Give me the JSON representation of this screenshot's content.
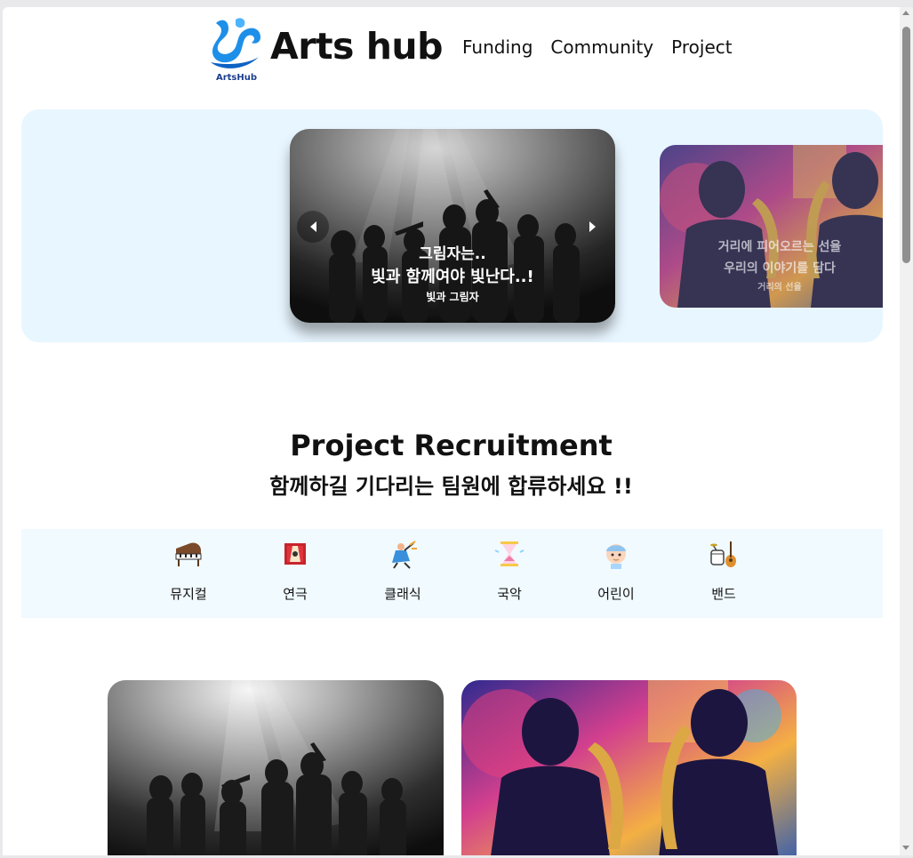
{
  "header": {
    "logo_caption": "ArtsHub",
    "brand_title": "Arts hub",
    "nav": [
      "Funding",
      "Community",
      "Project"
    ]
  },
  "banner": {
    "main_slide": {
      "line1": "그림자는..",
      "line2": "빛과 함께여야 빛난다..!",
      "line3": "빛과 그림자"
    },
    "next_slide": {
      "line1": "거리에 피어오르는 선율",
      "line2": "우리의 이야기를 담다",
      "line3": "거리의 선율"
    }
  },
  "section": {
    "title": "Project Recruitment",
    "subtitle": "함께하길 기다리는 팀원에 합류하세요 !!"
  },
  "categories": [
    {
      "label": "뮤지컬",
      "icon": "piano-icon"
    },
    {
      "label": "연극",
      "icon": "theater-icon"
    },
    {
      "label": "클래식",
      "icon": "dancer-icon"
    },
    {
      "label": "국악",
      "icon": "hourglass-icon"
    },
    {
      "label": "어린이",
      "icon": "child-icon"
    },
    {
      "label": "밴드",
      "icon": "band-icon"
    }
  ],
  "colors": {
    "banner_bg": "#e8f6ff",
    "category_bg": "#f1faff",
    "logo_blue": "#1e8fe8"
  }
}
